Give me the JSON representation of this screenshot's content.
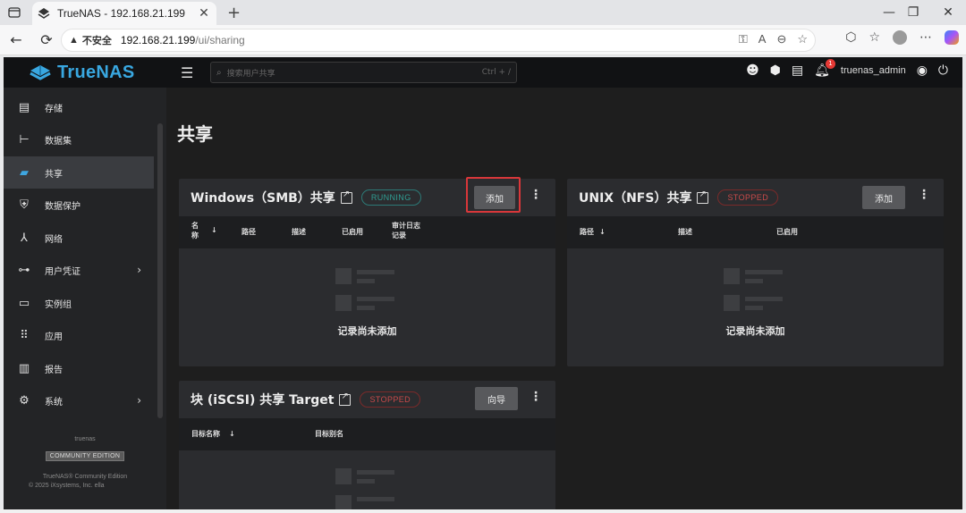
{
  "browser": {
    "tab_title": "TrueNAS - 192.168.21.199",
    "tab_close": "✕",
    "new_tab": "+",
    "security_label": "不安全",
    "url_host": "192.168.21.199",
    "url_path": "/ui/sharing",
    "window_controls": [
      "—",
      "❐",
      "✕"
    ]
  },
  "app": {
    "logo_text": "TrueNAS",
    "search_placeholder": "搜索用户共享",
    "search_shortcut": "Ctrl + /",
    "notification_count": "1",
    "username": "truenas_admin"
  },
  "sidebar": {
    "items": [
      {
        "label": "存储",
        "icon": "storage-icon"
      },
      {
        "label": "数据集",
        "icon": "datasets-icon"
      },
      {
        "label": "共享",
        "icon": "shares-icon",
        "active": true
      },
      {
        "label": "数据保护",
        "icon": "shield-icon"
      },
      {
        "label": "网络",
        "icon": "network-icon"
      },
      {
        "label": "用户凭证",
        "icon": "key-icon",
        "has_arrow": true
      },
      {
        "label": "实例组",
        "icon": "laptop-icon"
      },
      {
        "label": "应用",
        "icon": "apps-grid-icon"
      },
      {
        "label": "报告",
        "icon": "reports-icon"
      },
      {
        "label": "系统",
        "icon": "gear-icon",
        "has_arrow": true
      }
    ],
    "footer_name": "truenas",
    "edition": "COMMUNITY EDITION",
    "copyright_line1": "TrueNAS® Community Edition",
    "copyright_line2": "© 2025 iXsystems, Inc. ella"
  },
  "main": {
    "page_title": "共享",
    "smb": {
      "title": "Windows（SMB）共享",
      "status": "RUNNING",
      "add_label": "添加",
      "columns": [
        "名称",
        "路径",
        "描述",
        "已启用",
        "审计日志记录"
      ],
      "empty_text": "记录尚未添加"
    },
    "nfs": {
      "title": "UNIX（NFS）共享",
      "status": "STOPPED",
      "add_label": "添加",
      "columns": [
        "路径",
        "描述",
        "已启用"
      ],
      "empty_text": "记录尚未添加"
    },
    "iscsi": {
      "title": "块 (iSCSI) 共享 Target",
      "status": "STOPPED",
      "wizard_label": "向导",
      "columns": [
        "目标名称",
        "目标别名"
      ]
    }
  }
}
